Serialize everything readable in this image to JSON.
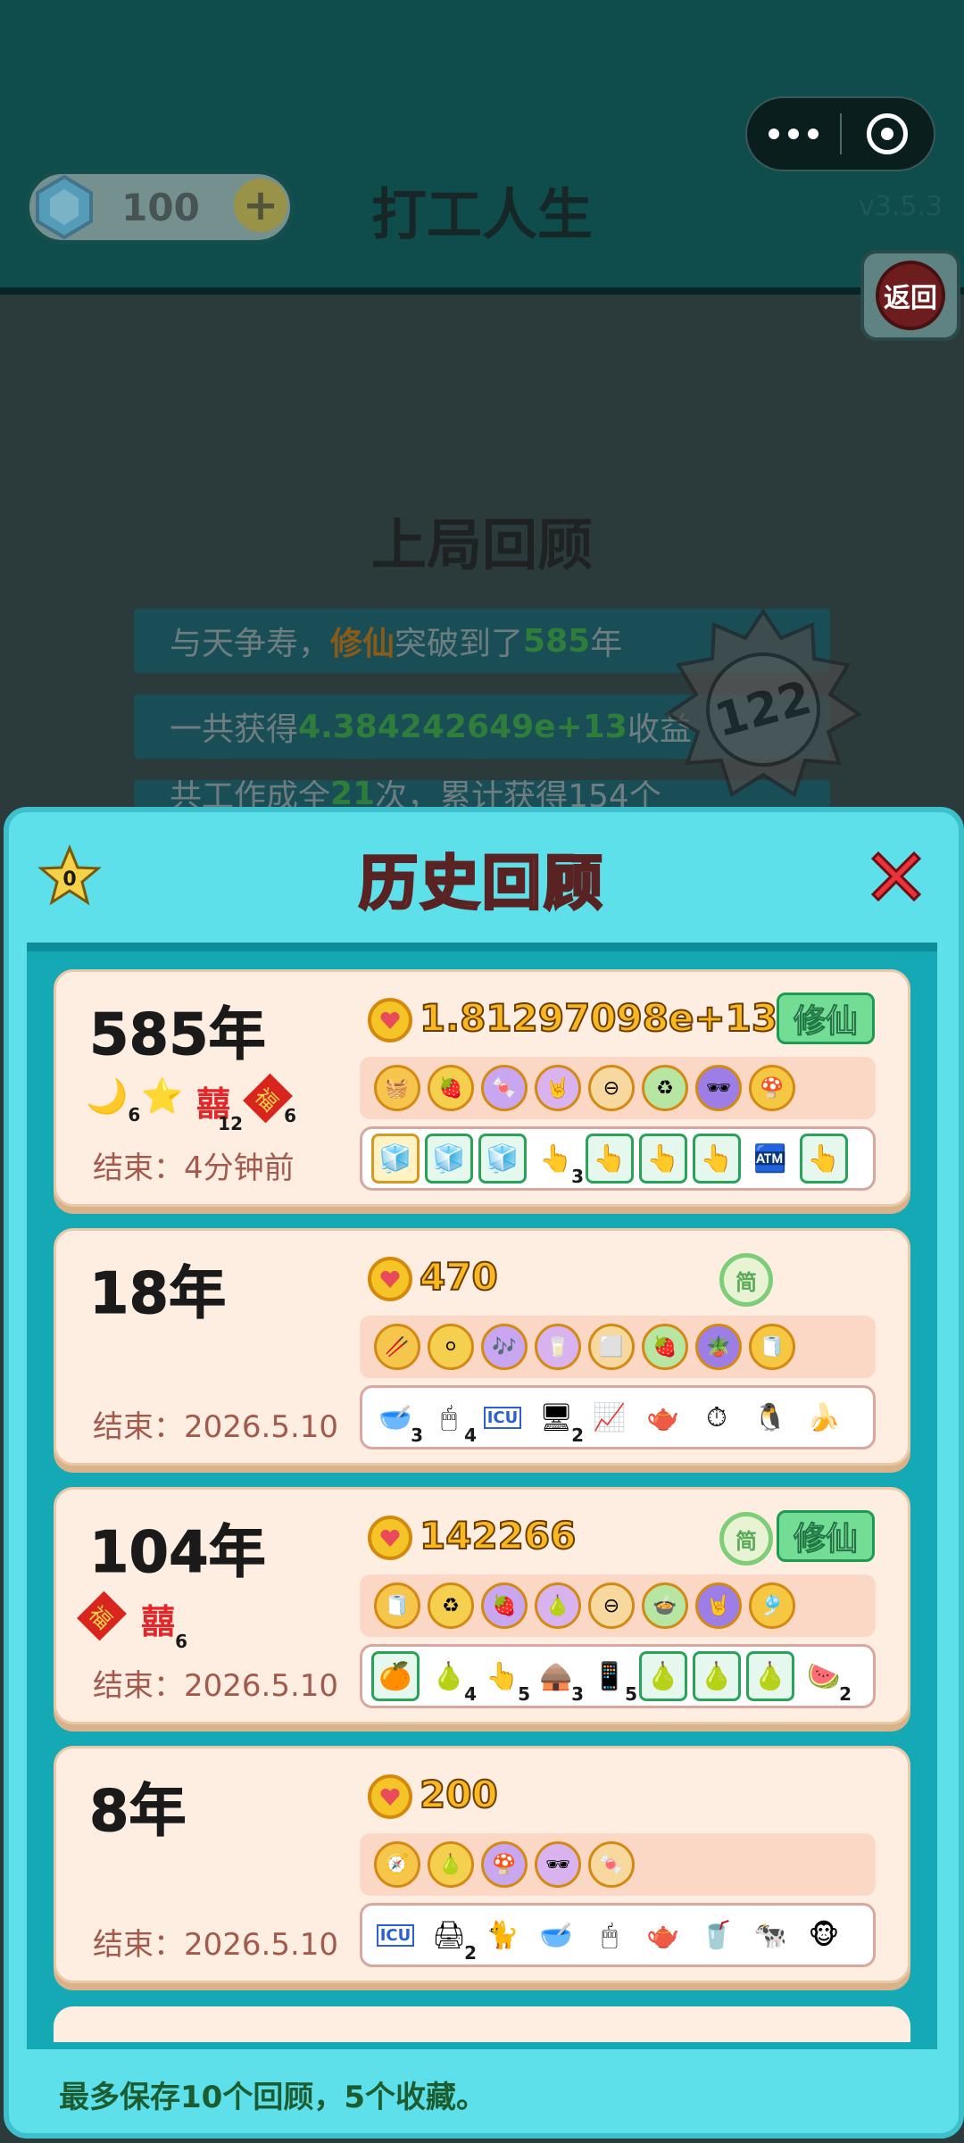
{
  "capsule": {
    "more_icon": "more-dots-icon",
    "close_icon": "target-circle-icon"
  },
  "header": {
    "gems": "100",
    "title": "打工人生",
    "version": "v3.5.3",
    "return_label": "返回"
  },
  "recap": {
    "title": "上局回顾",
    "rows": [
      {
        "prefix": "与天争寿，",
        "highlight1": "修仙",
        "mid": "突破到了",
        "highlight2": "585",
        "suffix": "年"
      },
      {
        "prefix": "一共获得",
        "highlight2": "4.384242649e+13",
        "suffix": "收益"
      },
      {
        "prefix": "共工作成全",
        "highlight2": "21",
        "suffix": "次，累计获得154个"
      }
    ],
    "medal_value": "122"
  },
  "modal": {
    "title": "历史回顾",
    "star_count": "0",
    "footer": "最多保存10个回顾，5个收藏。"
  },
  "cards": [
    {
      "years": "585年",
      "income": "1.81297098e+13",
      "tag_xx": "修仙",
      "ended": "结束：4分钟前",
      "badges": [
        {
          "glyph": "🌙",
          "count": "6"
        },
        {
          "glyph": "⭐",
          "count": ""
        },
        {
          "glyph": "囍",
          "count": "12"
        },
        {
          "glyph": "福",
          "count": "6"
        }
      ],
      "talents": [
        "🧺",
        "🍓",
        "🍬",
        "🤘",
        "⊖",
        "♻",
        "🕶",
        "🍄"
      ],
      "items": [
        {
          "g": "🧊",
          "c": "",
          "t": "sel"
        },
        {
          "g": "🧊",
          "c": "",
          "t": "framed"
        },
        {
          "g": "🧊",
          "c": "",
          "t": "framed"
        },
        {
          "g": "👆",
          "c": "3",
          "t": ""
        },
        {
          "g": "👆",
          "c": "",
          "t": "framed"
        },
        {
          "g": "👆",
          "c": "",
          "t": "framed"
        },
        {
          "g": "👆",
          "c": "",
          "t": "framed"
        },
        {
          "g": "🏧",
          "c": "",
          "t": ""
        },
        {
          "g": "👆",
          "c": "",
          "t": "framed"
        }
      ]
    },
    {
      "years": "18年",
      "income": "470",
      "tag_jian": "简",
      "ended": "结束：2026.5.10",
      "badges": [],
      "talents": [
        "🥢",
        "⚪",
        "🎶",
        "🥛",
        "⬜",
        "🍓",
        "🪴",
        "🧻"
      ],
      "items": [
        {
          "g": "🥣",
          "c": "3",
          "t": ""
        },
        {
          "g": "🖱",
          "c": "4",
          "t": ""
        },
        {
          "g": "ICU",
          "c": "",
          "t": ""
        },
        {
          "g": "🖥",
          "c": "2",
          "t": ""
        },
        {
          "g": "📈",
          "c": "",
          "t": ""
        },
        {
          "g": "🫖",
          "c": "",
          "t": ""
        },
        {
          "g": "⏱",
          "c": "",
          "t": ""
        },
        {
          "g": "🐧",
          "c": "",
          "t": ""
        },
        {
          "g": "🍌",
          "c": "",
          "t": ""
        }
      ]
    },
    {
      "years": "104年",
      "income": "142266",
      "tag_jian": "简",
      "tag_xx": "修仙",
      "ended": "结束：2026.5.10",
      "badges": [
        {
          "glyph": "福",
          "count": ""
        },
        {
          "glyph": "囍",
          "count": "6"
        }
      ],
      "talents": [
        "🧻",
        "♻",
        "🍓",
        "🍐",
        "⊖",
        "🍲",
        "🤘",
        "🎐"
      ],
      "items": [
        {
          "g": "🍊",
          "c": "",
          "t": "framed"
        },
        {
          "g": "🍐",
          "c": "4",
          "t": ""
        },
        {
          "g": "👆",
          "c": "5",
          "t": ""
        },
        {
          "g": "🛖",
          "c": "3",
          "t": ""
        },
        {
          "g": "📱",
          "c": "5",
          "t": ""
        },
        {
          "g": "🍐",
          "c": "",
          "t": "framed"
        },
        {
          "g": "🍐",
          "c": "",
          "t": "framed"
        },
        {
          "g": "🍐",
          "c": "",
          "t": "framed"
        },
        {
          "g": "🍉",
          "c": "2",
          "t": ""
        }
      ]
    },
    {
      "years": "8年",
      "income": "200",
      "ended": "结束：2026.5.10",
      "badges": [],
      "talents": [
        "🧭",
        "🍐",
        "🍄",
        "🕶",
        "🍬"
      ],
      "items": [
        {
          "g": "ICU",
          "c": "",
          "t": ""
        },
        {
          "g": "🖨",
          "c": "2",
          "t": ""
        },
        {
          "g": "🐈",
          "c": "",
          "t": ""
        },
        {
          "g": "🥣",
          "c": "",
          "t": ""
        },
        {
          "g": "🖱",
          "c": "",
          "t": ""
        },
        {
          "g": "🫖",
          "c": "",
          "t": ""
        },
        {
          "g": "🥤",
          "c": "",
          "t": ""
        },
        {
          "g": "🐄",
          "c": "",
          "t": ""
        },
        {
          "g": "🐵",
          "c": "",
          "t": ""
        }
      ]
    }
  ]
}
